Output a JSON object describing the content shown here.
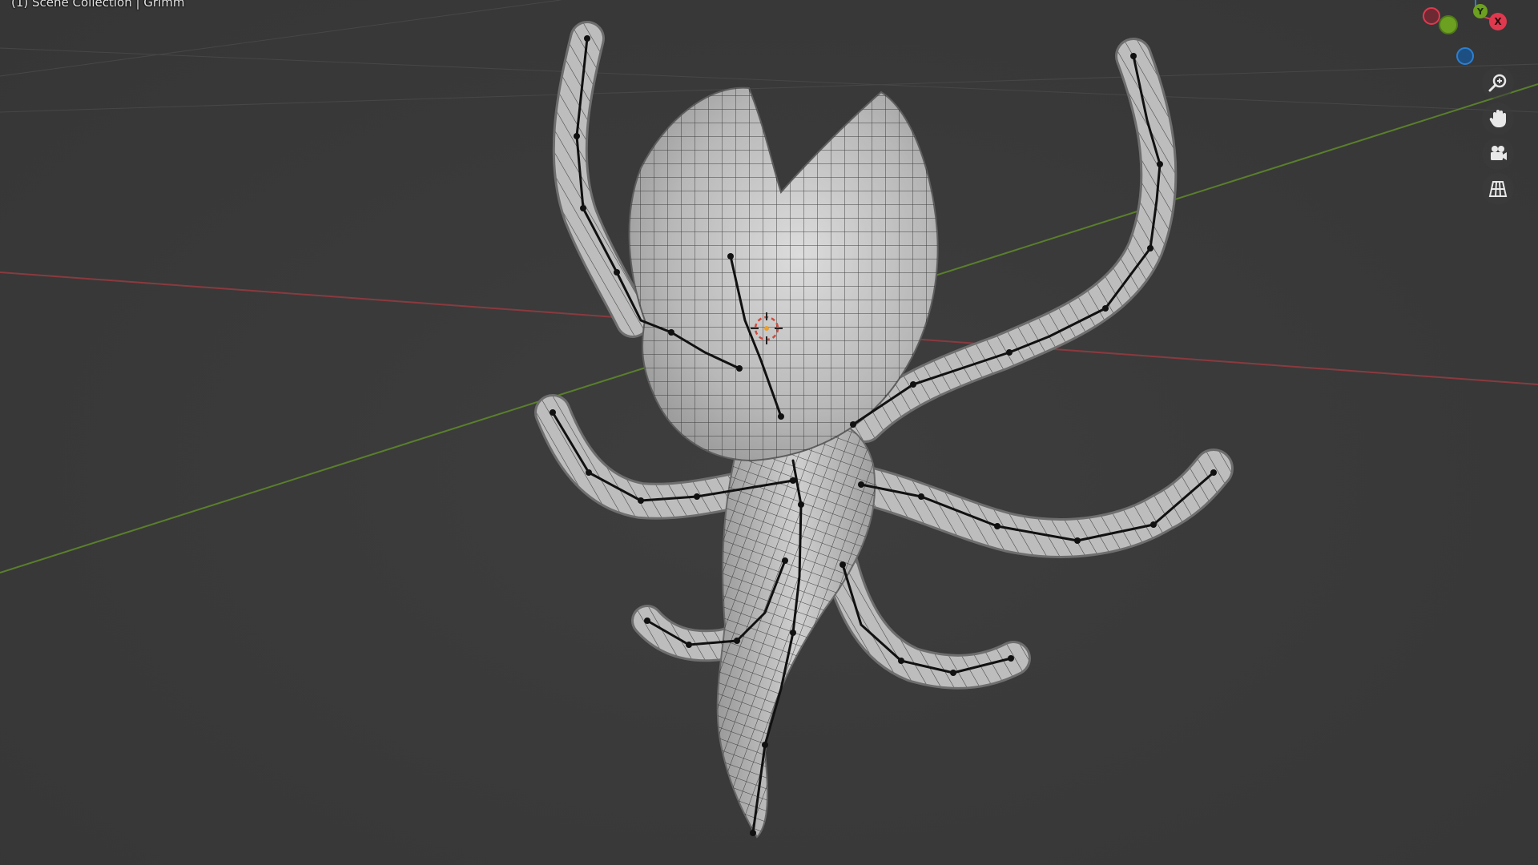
{
  "viewport": {
    "scene_label": "(1) Scene Collection | Grimm"
  },
  "gizmo": {
    "x_label": "X",
    "y_label": "Y",
    "x_color": "#e0394f",
    "y_color": "#6ca020",
    "z_color": "#2c7fd0"
  },
  "navigation_tools": [
    {
      "name": "zoom",
      "icon": "zoom-icon"
    },
    {
      "name": "pan",
      "icon": "hand-icon"
    },
    {
      "name": "camera",
      "icon": "camera-icon"
    },
    {
      "name": "orthographic",
      "icon": "grid-icon"
    }
  ],
  "colors": {
    "background": "#393939",
    "x_axis_line": "#8a3a3f",
    "y_axis_line": "#5a7f2c",
    "mesh_fill": "#b4b4b4",
    "wire": "#1a1a1a"
  }
}
